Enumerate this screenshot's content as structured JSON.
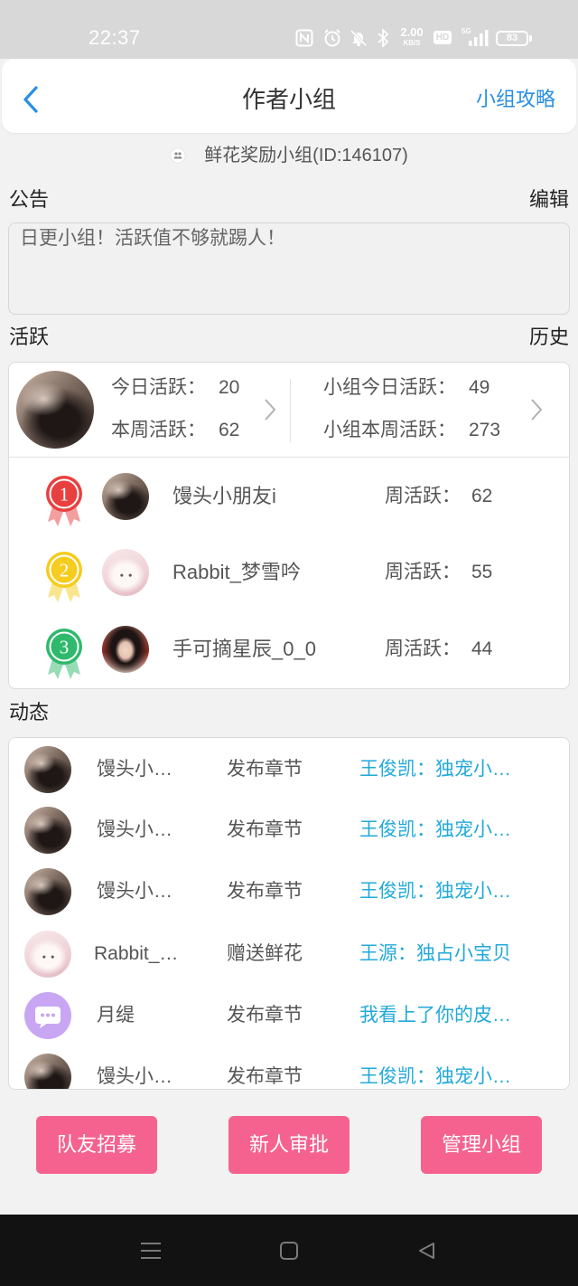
{
  "theme": {
    "accent": "#2a8fe6",
    "link": "#22a9d9",
    "button": "#f5628f",
    "page_bg": "#f2f2f2"
  },
  "status_bar": {
    "time": "22:37",
    "net_speed": "2.00",
    "net_speed_unit": "KB/S",
    "hd": "HD",
    "network": "5G",
    "battery": "83",
    "icons": [
      "nfc-icon",
      "alarm-icon",
      "bell-off-icon",
      "bluetooth-icon",
      "hd-icon",
      "signal-icon",
      "battery-icon"
    ]
  },
  "header": {
    "back_icon": "back-chevron-icon",
    "title": "作者小组",
    "guide_link": "小组攻略"
  },
  "group": {
    "icon": "group-members-icon",
    "name_with_id": "鲜花奖励小组(ID:146107)"
  },
  "announcement": {
    "label": "公告",
    "edit_label": "编辑",
    "text": "日更小组！活跃值不够就踢人！"
  },
  "activity": {
    "label": "活跃",
    "history_label": "历史",
    "personal": {
      "today_label": "今日活跃：",
      "today_value": "20",
      "week_label": "本周活跃：",
      "week_value": "62"
    },
    "group": {
      "today_label": "小组今日活跃：",
      "today_value": "49",
      "week_label": "小组本周活跃：",
      "week_value": "273"
    }
  },
  "ranking": [
    {
      "rank": "1",
      "name": "馒头小朋友i",
      "week_label": "周活跃：",
      "week_value": "62",
      "medal_color": "#e8403f"
    },
    {
      "rank": "2",
      "name": "Rabbit_梦雪吟",
      "week_label": "周活跃：",
      "week_value": "55",
      "medal_color": "#f5cc1f"
    },
    {
      "rank": "3",
      "name": "手可摘星辰_0_0",
      "week_label": "周活跃：",
      "week_value": "44",
      "medal_color": "#2fb96c"
    }
  ],
  "feed": {
    "label": "动态",
    "items": [
      {
        "name": "馒头小…",
        "action": "发布章节",
        "target": "王俊凯：独宠小…"
      },
      {
        "name": "馒头小…",
        "action": "发布章节",
        "target": "王俊凯：独宠小…"
      },
      {
        "name": "馒头小…",
        "action": "发布章节",
        "target": "王俊凯：独宠小…"
      },
      {
        "name": "Rabbit_…",
        "action": "赠送鲜花",
        "target": "王源：独占小宝贝"
      },
      {
        "name": "月缇",
        "action": "发布章节",
        "target": "我看上了你的皮…"
      },
      {
        "name": "馒头小…",
        "action": "发布章节",
        "target": "王俊凯：独宠小…"
      }
    ]
  },
  "actions": {
    "recruit": "队友招募",
    "approve": "新人审批",
    "manage": "管理小组"
  },
  "nav": {
    "icons": [
      "menu-icon",
      "home-square-icon",
      "back-triangle-icon"
    ]
  }
}
